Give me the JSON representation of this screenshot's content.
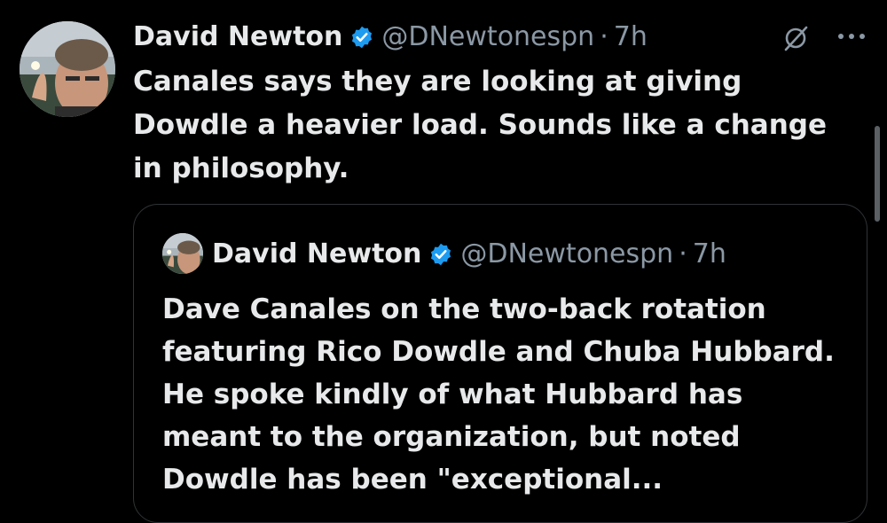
{
  "tweet": {
    "author_name": "David Newton",
    "handle": "@DNewtonespn",
    "separator": "·",
    "time": "7h",
    "text": "Canales says they are looking at giving\nDowdle a heavier load. Sounds like a change\nin philosophy.",
    "verified_color": "#1d9bf0",
    "grok_icon": "grok-slash-circle-icon",
    "more_icon": "more-dots-icon"
  },
  "quote": {
    "author_name": "David Newton",
    "handle": "@DNewtonespn",
    "separator": "·",
    "time": "7h",
    "text": "Dave Canales on the two-back rotation featuring Rico Dowdle and Chuba Hubbard. He spoke kindly of what Hubbard has meant to the organization, but noted Dowdle has been \"exceptional..."
  }
}
